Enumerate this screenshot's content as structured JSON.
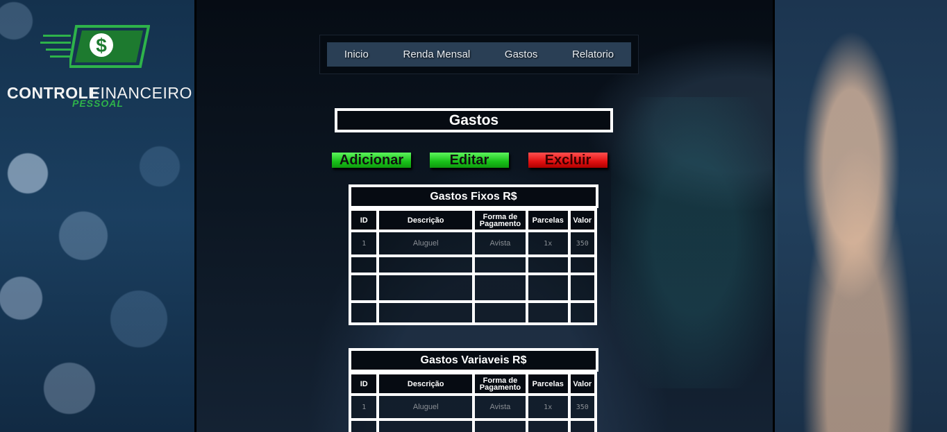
{
  "logo": {
    "symbol": "$",
    "text_bold": "CONTROLE",
    "text_light": "FINANCEIRO",
    "text_sub": "PESSOAL",
    "accent_color": "#2eb34a"
  },
  "nav": {
    "items": [
      {
        "label": "Inicio"
      },
      {
        "label": "Renda Mensal"
      },
      {
        "label": "Gastos"
      },
      {
        "label": "Relatorio"
      }
    ]
  },
  "page_title": "Gastos",
  "actions": {
    "add": "Adicionar",
    "edit": "Editar",
    "delete": "Excluir"
  },
  "fixed_table": {
    "title": "Gastos Fixos R$",
    "columns": [
      "ID",
      "Descrição",
      "Forma de Pagamento",
      "Parcelas",
      "Valor"
    ],
    "rows": [
      [
        "1",
        "Aluguel",
        "Avista",
        "1x",
        "350"
      ]
    ]
  },
  "variable_table": {
    "title": "Gastos Variaveis R$",
    "columns": [
      "ID",
      "Descrição",
      "Forma de Pagamento",
      "Parcelas",
      "Valor"
    ],
    "rows": [
      [
        "1",
        "Aluguel",
        "Avista",
        "1x",
        "350"
      ]
    ]
  }
}
